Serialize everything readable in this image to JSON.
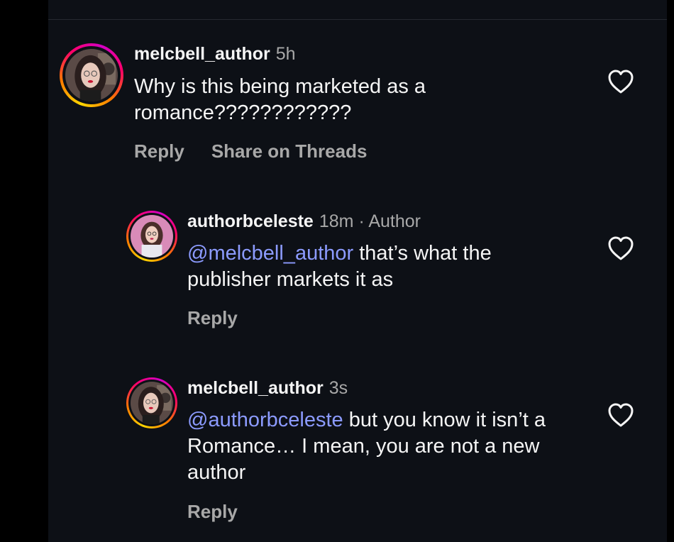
{
  "comments": [
    {
      "username": "melcbell_author",
      "time": "5h",
      "mention": "",
      "text": "Why is this being marketed as a romance????????????",
      "reply_label": "Reply",
      "share_label": "Share on Threads"
    },
    {
      "username": "authorbceleste",
      "time": "18m",
      "author_tag": "· Author",
      "mention": "@melcbell_author",
      "text": " that’s what the publisher markets it as",
      "reply_label": "Reply"
    },
    {
      "username": "melcbell_author",
      "time": "3s",
      "mention": "@authorbceleste",
      "text": " but you know it isn’t a Romance… I mean, you are not a new author",
      "reply_label": "Reply"
    }
  ],
  "icons": {
    "like": "heart-outline-icon"
  },
  "colors": {
    "background": "#0d1016",
    "mention": "#8c9bff",
    "secondary_text": "#a8a8a8"
  }
}
